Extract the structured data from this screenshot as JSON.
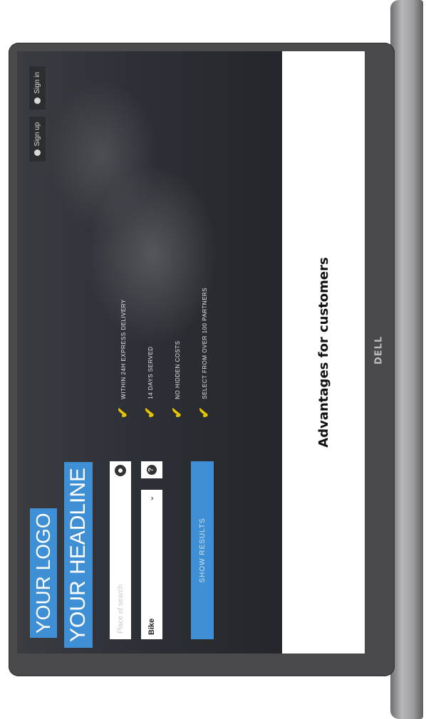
{
  "page": {
    "logo": "YOUR LOGO",
    "headline": "YOUR HEADLINE",
    "nav": {
      "sign_up": "Sign up",
      "sign_in": "Sign in"
    },
    "form": {
      "location_placeholder": "Place of search",
      "category_value": "Bike",
      "help_glyph": "?",
      "search_button": "SHOW RESULTS"
    },
    "benefits": [
      "WITHIN 24H EXPRESS DELIVERY",
      "14 DAYS SERVED",
      "NO HIDDEN COSTS",
      "SELECT FROM OVER 100 PARTNERS"
    ],
    "check_glyph": "✔",
    "chevron_glyph": "⌄"
  },
  "caption": "Advantages for customers",
  "device": {
    "brand": "DELL"
  },
  "colors": {
    "accent": "#3f8fd4",
    "check": "#e6c400"
  }
}
